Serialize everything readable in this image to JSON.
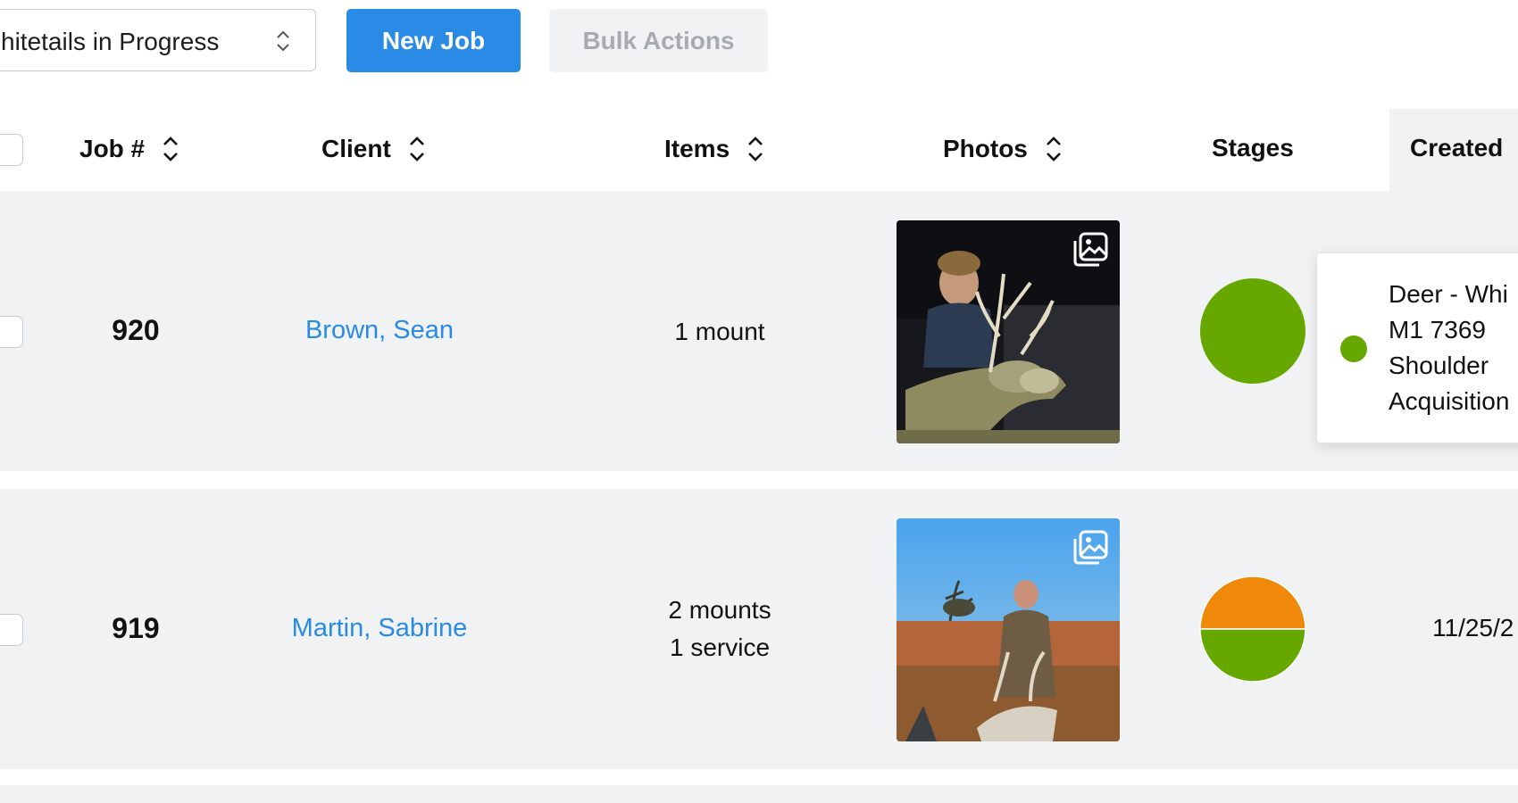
{
  "toolbar": {
    "filter_value": "hitetails in Progress",
    "new_job_label": "New Job",
    "bulk_actions_label": "Bulk Actions"
  },
  "colors": {
    "accent": "#2a8be6",
    "stage_green": "#67a800",
    "stage_orange": "#f0890a",
    "row_bg": "#f1f2f4"
  },
  "table": {
    "columns": [
      "Job #",
      "Client",
      "Items",
      "Photos",
      "Stages",
      "Created"
    ],
    "rows": [
      {
        "job": "920",
        "client": "Brown, Sean",
        "items": [
          "1 mount"
        ],
        "stages": [
          {
            "color": "#67a800",
            "fraction": 1.0
          }
        ],
        "created": ""
      },
      {
        "job": "919",
        "client": "Martin, Sabrine",
        "items": [
          "2 mounts",
          "1 service"
        ],
        "stages": [
          {
            "color": "#f0890a",
            "fraction": 0.5
          },
          {
            "color": "#67a800",
            "fraction": 0.5
          }
        ],
        "created": "11/25/2"
      }
    ]
  },
  "tooltip": {
    "lines": [
      "Deer - Whi",
      "M1 7369",
      "Shoulder",
      "Acquisition"
    ],
    "dot_color": "#67a800"
  },
  "icons": {
    "sort": "sort-updown-icon",
    "gallery": "photo-gallery-icon",
    "select_chevron": "select-updown-icon"
  }
}
